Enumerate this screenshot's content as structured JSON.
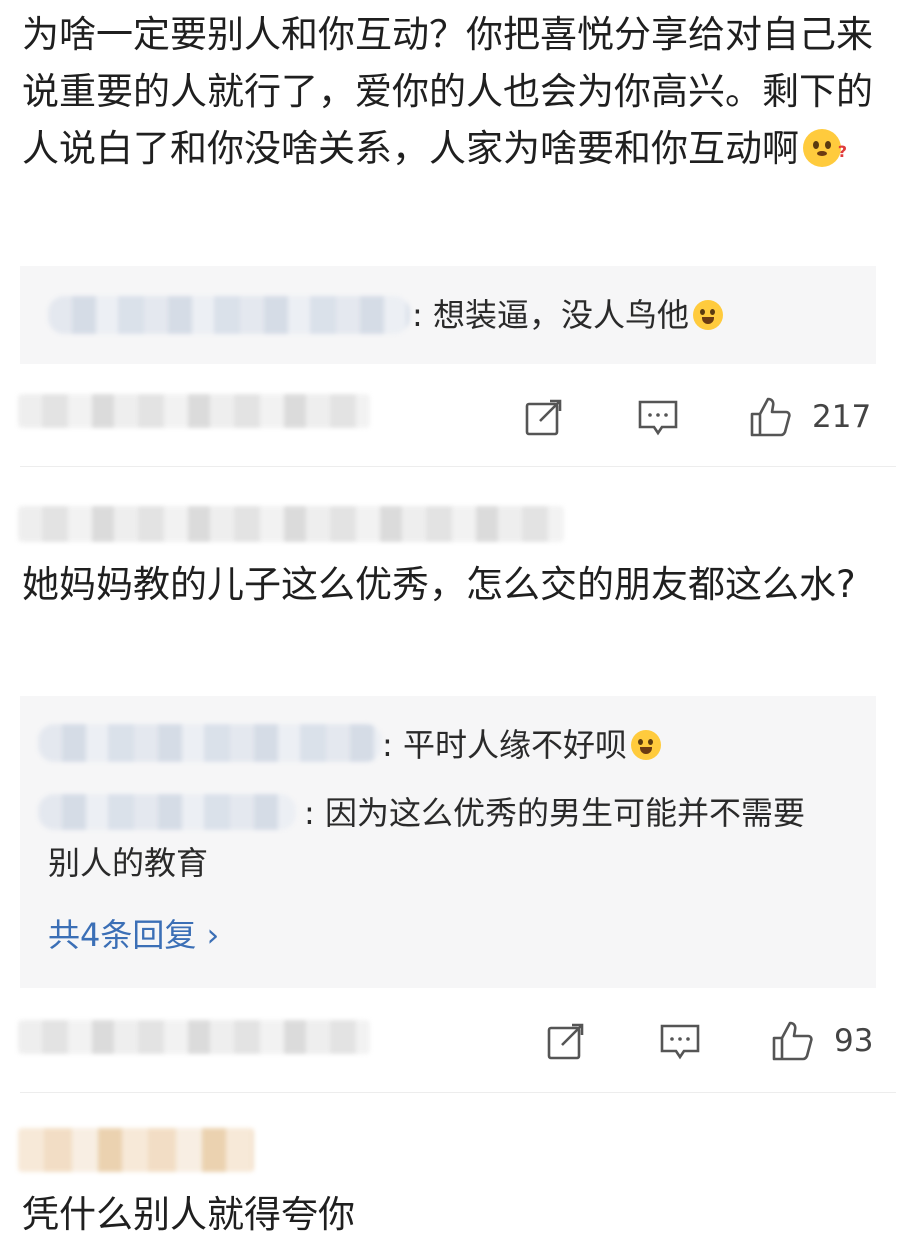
{
  "comments": [
    {
      "text": "为啥一定要别人和你互动？你把喜悦分享给对自己来说重要的人就行了，爱你的人也会为你高兴。剩下的人说白了和你没啥关系，人家为啥要和你互动啊",
      "emoji": "confused-face",
      "replies": [
        {
          "text": ": 想装逼，没人鸟他",
          "emoji": "crying-laughing-face"
        }
      ],
      "likes": "217"
    },
    {
      "text": "她妈妈教的儿子这么优秀，怎么交的朋友都这么水?",
      "replies": [
        {
          "text": ": 平时人缘不好呗",
          "emoji": "laughing-face"
        },
        {
          "text": ": 因为这么优秀的男生可能并不需要别人的教育"
        }
      ],
      "expand_label": "共4条回复 ›",
      "likes": "93"
    },
    {
      "text": "凭什么别人就得夸你"
    }
  ],
  "colors": {
    "link": "#3b6fb6",
    "reply_bg": "#f6f6f7",
    "emoji": "#ffcb3d"
  }
}
